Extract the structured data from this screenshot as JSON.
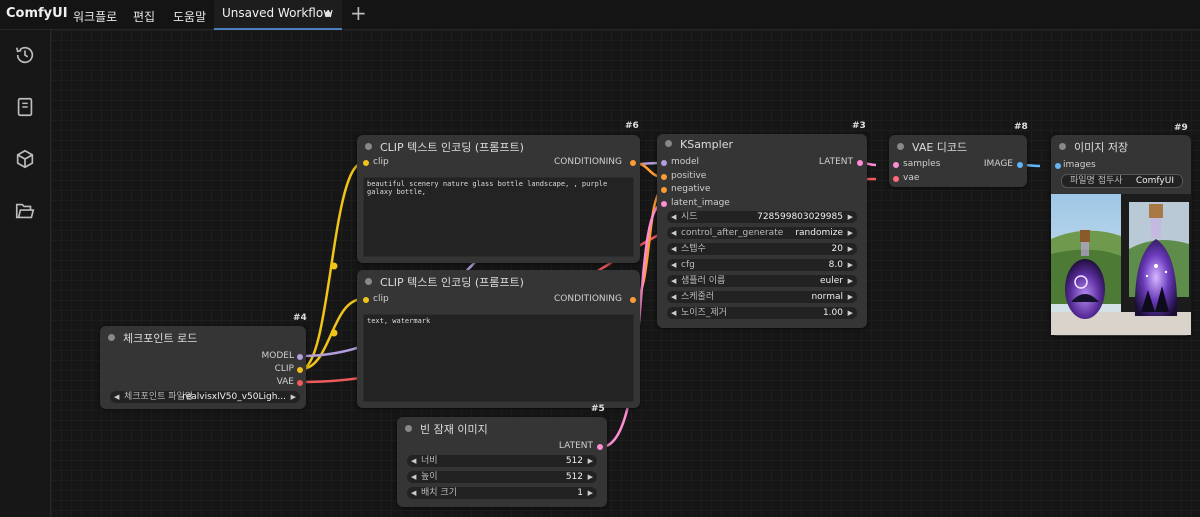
{
  "app": {
    "logo": "ComfyUI"
  },
  "menu": [
    "워크플로",
    "편집",
    "도움말"
  ],
  "tab": {
    "label": "Unsaved Workflow"
  },
  "nodes": {
    "clip_pos": {
      "id": "#6",
      "title": "CLIP 텍스트 인코딩 (프롬프트)",
      "input": "clip",
      "output": "CONDITIONING",
      "text": "beautiful scenery nature glass bottle landscape, , purple galaxy bottle,"
    },
    "clip_neg": {
      "title": "CLIP 텍스트 인코딩 (프롬프트)",
      "input": "clip",
      "output": "CONDITIONING",
      "text": "text, watermark"
    },
    "ksampler": {
      "id": "#3",
      "title": "KSampler",
      "inputs": [
        "model",
        "positive",
        "negative",
        "latent_image"
      ],
      "output": "LATENT",
      "widgets": [
        {
          "label": "시드",
          "value": "728599803029985"
        },
        {
          "label": "control_after_generate",
          "value": "randomize"
        },
        {
          "label": "스텝수",
          "value": "20"
        },
        {
          "label": "cfg",
          "value": "8.0"
        },
        {
          "label": "샘플러 이름",
          "value": "euler"
        },
        {
          "label": "스케줄러",
          "value": "normal"
        },
        {
          "label": "노이즈_제거",
          "value": "1.00"
        }
      ]
    },
    "vae": {
      "id": "#8",
      "title": "VAE 디코드",
      "inputs": [
        "samples",
        "vae"
      ],
      "output": "IMAGE"
    },
    "save": {
      "id": "#9",
      "title": "이미지 저장",
      "input": "images",
      "widget": {
        "label": "파일명 접두사",
        "value": "ComfyUI"
      }
    },
    "checkpoint": {
      "id": "#4",
      "title": "체크포인트 로드",
      "outputs": [
        "MODEL",
        "CLIP",
        "VAE"
      ],
      "widget": {
        "label": "체크포인트 파일명",
        "value": "realvisxlV50_v50Ligh..."
      }
    },
    "latent": {
      "id": "#5",
      "title": "빈 잠재 이미지",
      "output": "LATENT",
      "widgets": [
        {
          "label": "너비",
          "value": "512"
        },
        {
          "label": "높이",
          "value": "512"
        },
        {
          "label": "배치 크기",
          "value": "1"
        }
      ]
    }
  },
  "colors": {
    "clip": "#f0c419",
    "model": "#b39ddb",
    "vae": "#ef5b5b",
    "conditioning": "#ff9c33",
    "latent": "#ff8dd6",
    "image": "#64b5f6"
  }
}
